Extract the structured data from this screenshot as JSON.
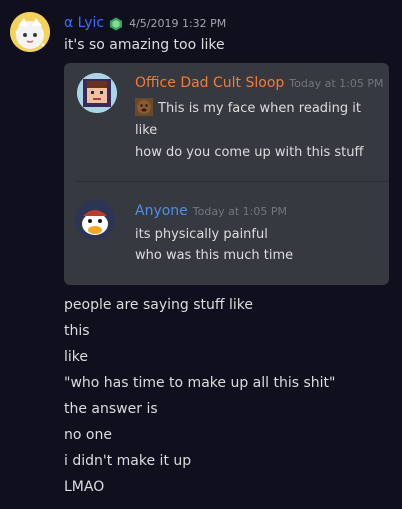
{
  "message": {
    "author": "α Lyic",
    "timestamp": "4/5/2019 1:32 PM",
    "author_color": "#3d6cff",
    "badge_icon": "green-hexagon-badge-icon",
    "lines_before": [
      "it's so amazing too like"
    ],
    "lines_after": [
      "people are saying stuff like",
      "this",
      "like",
      "\"who has time to make up all this shit\"",
      "the answer is",
      "no one",
      "i didn't make it up",
      "LMAO"
    ]
  },
  "quoted": [
    {
      "author": "Office Dad Cult Sloop",
      "timestamp": "Today at 1:05 PM",
      "author_color": "#f47b38",
      "emoji_icon": "face-emoji-icon",
      "lines": [
        "This is my face when reading it",
        "like",
        "how do you come up with this stuff"
      ]
    },
    {
      "author": "Anyone",
      "timestamp": "Today at 1:05 PM",
      "author_color": "#4e8fe8",
      "lines": [
        "its physically painful",
        "who was this much time"
      ]
    }
  ]
}
